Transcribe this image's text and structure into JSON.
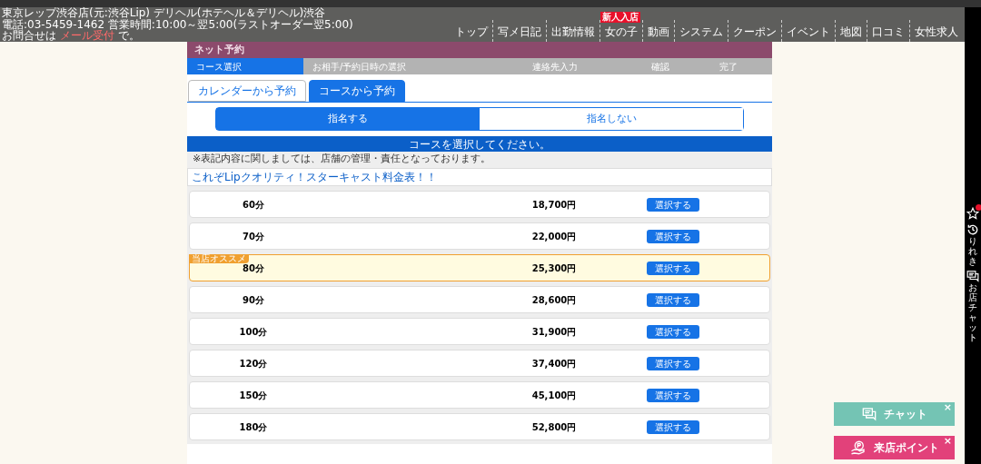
{
  "header": {
    "lines": [
      "東京レップ渋谷店(元:渋谷Lip) デリヘル(ホテヘル＆デリヘル)渋谷",
      "電話:03-5459-1462 営業時間:10:00～翌5:00(ラストオーダー翌5:00)"
    ],
    "contact_prefix": "お問合せは",
    "contact_link": "メール受付",
    "contact_suffix": "で。"
  },
  "nav": [
    {
      "label": "トップ"
    },
    {
      "label": "写メ日記"
    },
    {
      "label": "出勤情報"
    },
    {
      "label": "女の子",
      "badge": "新人入店"
    },
    {
      "label": "動画"
    },
    {
      "label": "システム"
    },
    {
      "label": "クーポン"
    },
    {
      "label": "イベント"
    },
    {
      "label": "地図"
    },
    {
      "label": "口コミ"
    },
    {
      "label": "女性求人"
    }
  ],
  "title": "ネット予約",
  "steps": [
    {
      "label": "コース選択",
      "selected": true
    },
    {
      "label": "お相手/予約日時の選択",
      "selected": false
    },
    {
      "label": "連絡先入力",
      "selected": false
    },
    {
      "label": "確認",
      "selected": false
    },
    {
      "label": "完了",
      "selected": false
    }
  ],
  "tabs": [
    {
      "label": "カレンダーから予約",
      "selected": false
    },
    {
      "label": "コースから予約",
      "selected": true
    }
  ],
  "toggle": [
    {
      "label": "指名する",
      "selected": true
    },
    {
      "label": "指名しない",
      "selected": false
    }
  ],
  "banner": "コースを選択してください。",
  "note": "※表記内容に関しましては、店舗の管理・責任となっております。",
  "price_link": "これぞLipクオリティ！スターキャスト料金表！！",
  "courses": [
    {
      "duration": "60分",
      "price": "18,700円",
      "button": "選択する",
      "selected": false
    },
    {
      "duration": "70分",
      "price": "22,000円",
      "button": "選択する",
      "selected": false
    },
    {
      "duration": "80分",
      "price": "25,300円",
      "button": "選択する",
      "selected": true,
      "badge": "当店オススメ"
    },
    {
      "duration": "90分",
      "price": "28,600円",
      "button": "選択する",
      "selected": false
    },
    {
      "duration": "100分",
      "price": "31,900円",
      "button": "選択する",
      "selected": false
    },
    {
      "duration": "120分",
      "price": "37,400円",
      "button": "選択する",
      "selected": false
    },
    {
      "duration": "150分",
      "price": "45,100円",
      "button": "選択する",
      "selected": false
    },
    {
      "duration": "180分",
      "price": "52,800円",
      "button": "選択する",
      "selected": false
    }
  ],
  "side_tools": [
    {
      "kind": "favorite"
    },
    {
      "kind": "history",
      "label": "りれき"
    },
    {
      "kind": "chat",
      "label": "お店チャット"
    }
  ],
  "floating": [
    {
      "kind": "chat",
      "label": "チャット",
      "close": "×"
    },
    {
      "kind": "points",
      "label": "来店ポイント",
      "close": "×"
    }
  ]
}
